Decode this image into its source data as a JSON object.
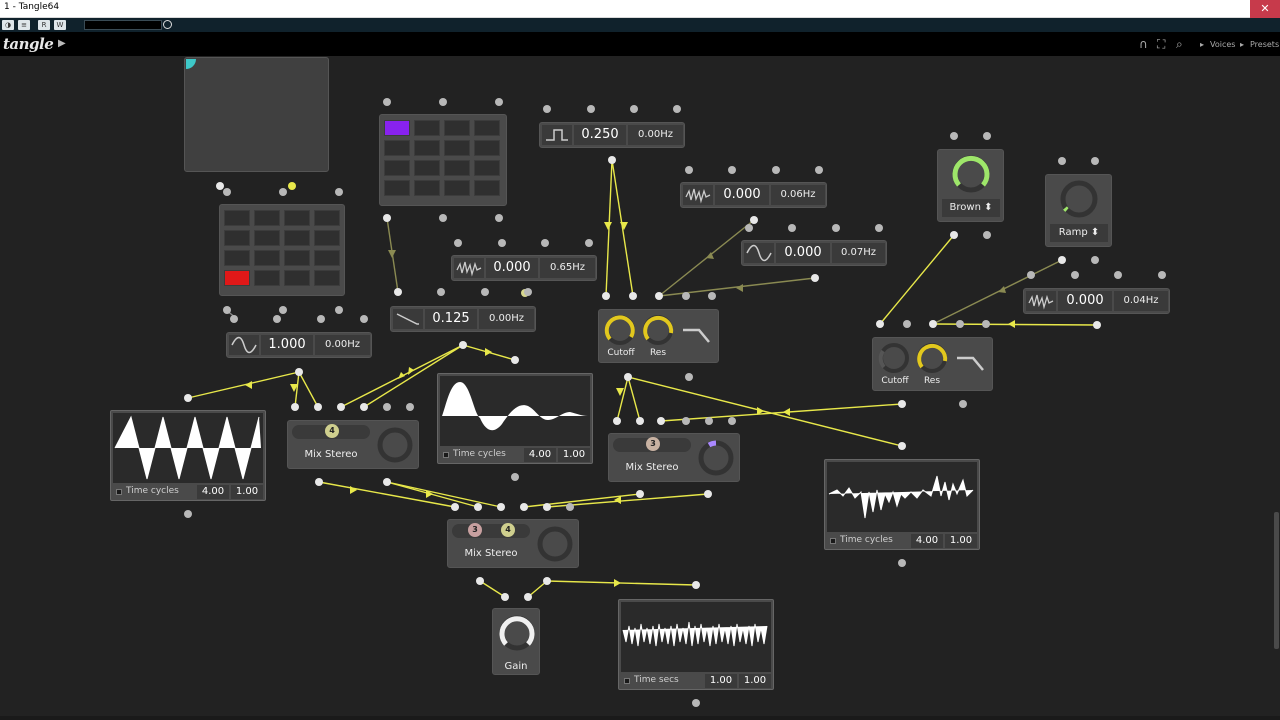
{
  "window": {
    "title": "1 - Tangle64",
    "close_glyph": "✕"
  },
  "host_toolbar": {
    "buttons": [
      "◑",
      "≡",
      "R",
      "W"
    ]
  },
  "app": {
    "logo": "tangle",
    "voices_label": "Voices",
    "presets_label": "Presets",
    "icons": [
      "headphones-icon",
      "fullscreen-icon",
      "search-icon",
      "play-icon"
    ]
  },
  "colors": {
    "background": "#222222",
    "module": "#4a4a4a",
    "cable": "#e8e84a",
    "cable_dim": "#8a8a52",
    "seq_purple": "#8822ee",
    "seq_red": "#e01818",
    "knob_yellow": "#e2c81e",
    "knob_green": "#9ee66a"
  },
  "oscillators": {
    "square": {
      "value": "0.250",
      "freq": "0.00Hz",
      "wave": "square-wave-icon"
    },
    "noise1": {
      "value": "0.000",
      "freq": "0.06Hz",
      "wave": "noise-wave-icon"
    },
    "sine1": {
      "value": "0.000",
      "freq": "0.07Hz",
      "wave": "sine-wave-icon"
    },
    "noise2": {
      "value": "0.000",
      "freq": "0.65Hz",
      "wave": "noise-wave-icon"
    },
    "saw": {
      "value": "0.125",
      "freq": "0.00Hz",
      "wave": "saw-wave-icon"
    },
    "sine2": {
      "value": "1.000",
      "freq": "0.00Hz",
      "wave": "sine-wave-icon"
    },
    "noise3": {
      "value": "0.000",
      "freq": "0.04Hz",
      "wave": "noise-wave-icon"
    }
  },
  "filters": [
    {
      "cutoff_label": "Cutoff",
      "res_label": "Res"
    },
    {
      "cutoff_label": "Cutoff",
      "res_label": "Res"
    }
  ],
  "noise_source": {
    "type": "Brown"
  },
  "ramp_source": {
    "type": "Ramp"
  },
  "mixers": [
    {
      "label": "Mix Stereo",
      "channels": [
        "4"
      ]
    },
    {
      "label": "Mix Stereo",
      "channels": [
        "3"
      ]
    },
    {
      "label": "Mix Stereo",
      "channels": [
        "3",
        "4"
      ]
    }
  ],
  "gain": {
    "label": "Gain"
  },
  "scopes": [
    {
      "label": "Time cycles",
      "a": "4.00",
      "b": "1.00"
    },
    {
      "label": "Time cycles",
      "a": "4.00",
      "b": "1.00"
    },
    {
      "label": "Time cycles",
      "a": "4.00",
      "b": "1.00"
    },
    {
      "label": "Time secs",
      "a": "1.00",
      "b": "1.00"
    }
  ]
}
